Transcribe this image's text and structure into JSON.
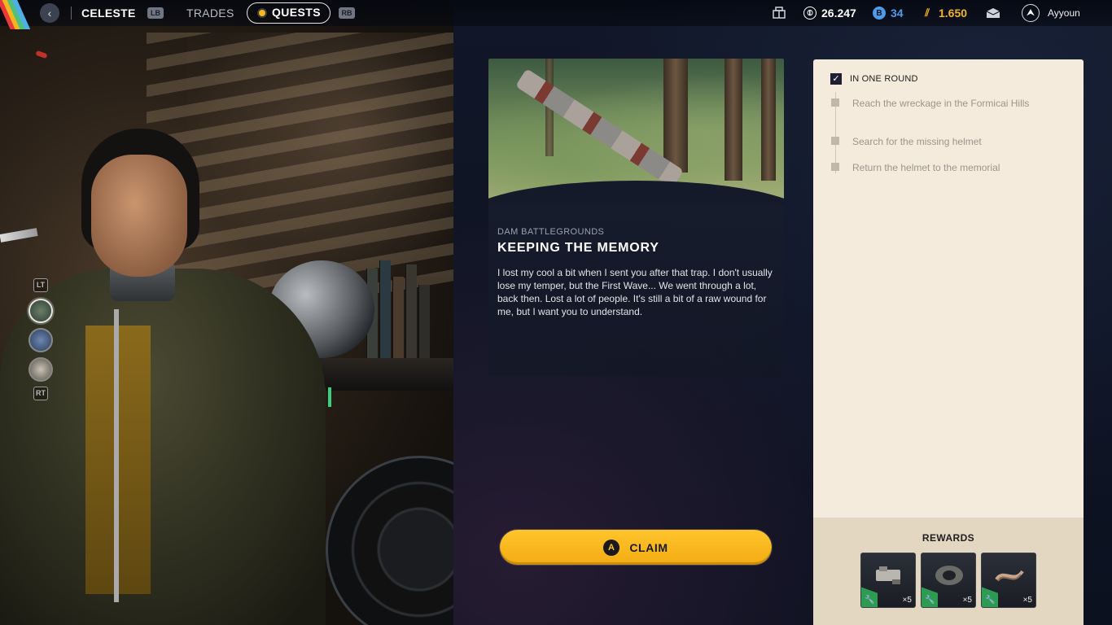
{
  "topbar": {
    "back_icon": "chevron-left-icon",
    "character_name": "CELESTE",
    "lb_glyph": "LB",
    "trades_label": "TRADES",
    "quests_label": "QUESTS",
    "rb_glyph": "RB",
    "currencies": [
      {
        "icon": "inventory-icon",
        "value": ""
      },
      {
        "icon": "coins-icon",
        "value": "26.247",
        "color": "#ffffff"
      },
      {
        "icon": "token-icon",
        "value": "34",
        "color": "#4c9be8"
      },
      {
        "icon": "raider-tokens-icon",
        "value": "1.650",
        "color": "#f5b51f"
      }
    ],
    "mail_icon": "mail-icon",
    "username": "Ayyoun",
    "avatar_icon": "rank-icon"
  },
  "side_nav": {
    "lt_glyph": "LT",
    "rt_glyph": "RT",
    "thumb_count_visible": 3,
    "active_index": 0
  },
  "quest": {
    "region": "DAM BATTLEGROUNDS",
    "title": "KEEPING THE MEMORY",
    "description": "I lost my cool a bit when I sent you after that trap. I don't usually lose my temper, but the First Wave... We went through a lot, back then. Lost a lot of people. It's still a bit of a raw wound for me, but I want you to understand."
  },
  "claim_button": {
    "glyph": "A",
    "label": "CLAIM",
    "color": "#ffc42c"
  },
  "objectives": {
    "header_checked": true,
    "header_check_mark": "✓",
    "header_label": "IN ONE ROUND",
    "items": [
      {
        "label": "Reach the wreckage in the Formicai Hills",
        "done": false
      },
      {
        "label": "Search for the missing helmet",
        "done": false
      },
      {
        "label": "Return the helmet to the memorial",
        "done": false
      }
    ]
  },
  "rewards": {
    "title": "REWARDS",
    "items": [
      {
        "icon": "mechanical-part-icon",
        "quantity": "×5"
      },
      {
        "icon": "tape-roll-icon",
        "quantity": "×5"
      },
      {
        "icon": "wire-cable-icon",
        "quantity": "×5"
      }
    ],
    "rarity_color": "#2e9b52"
  }
}
